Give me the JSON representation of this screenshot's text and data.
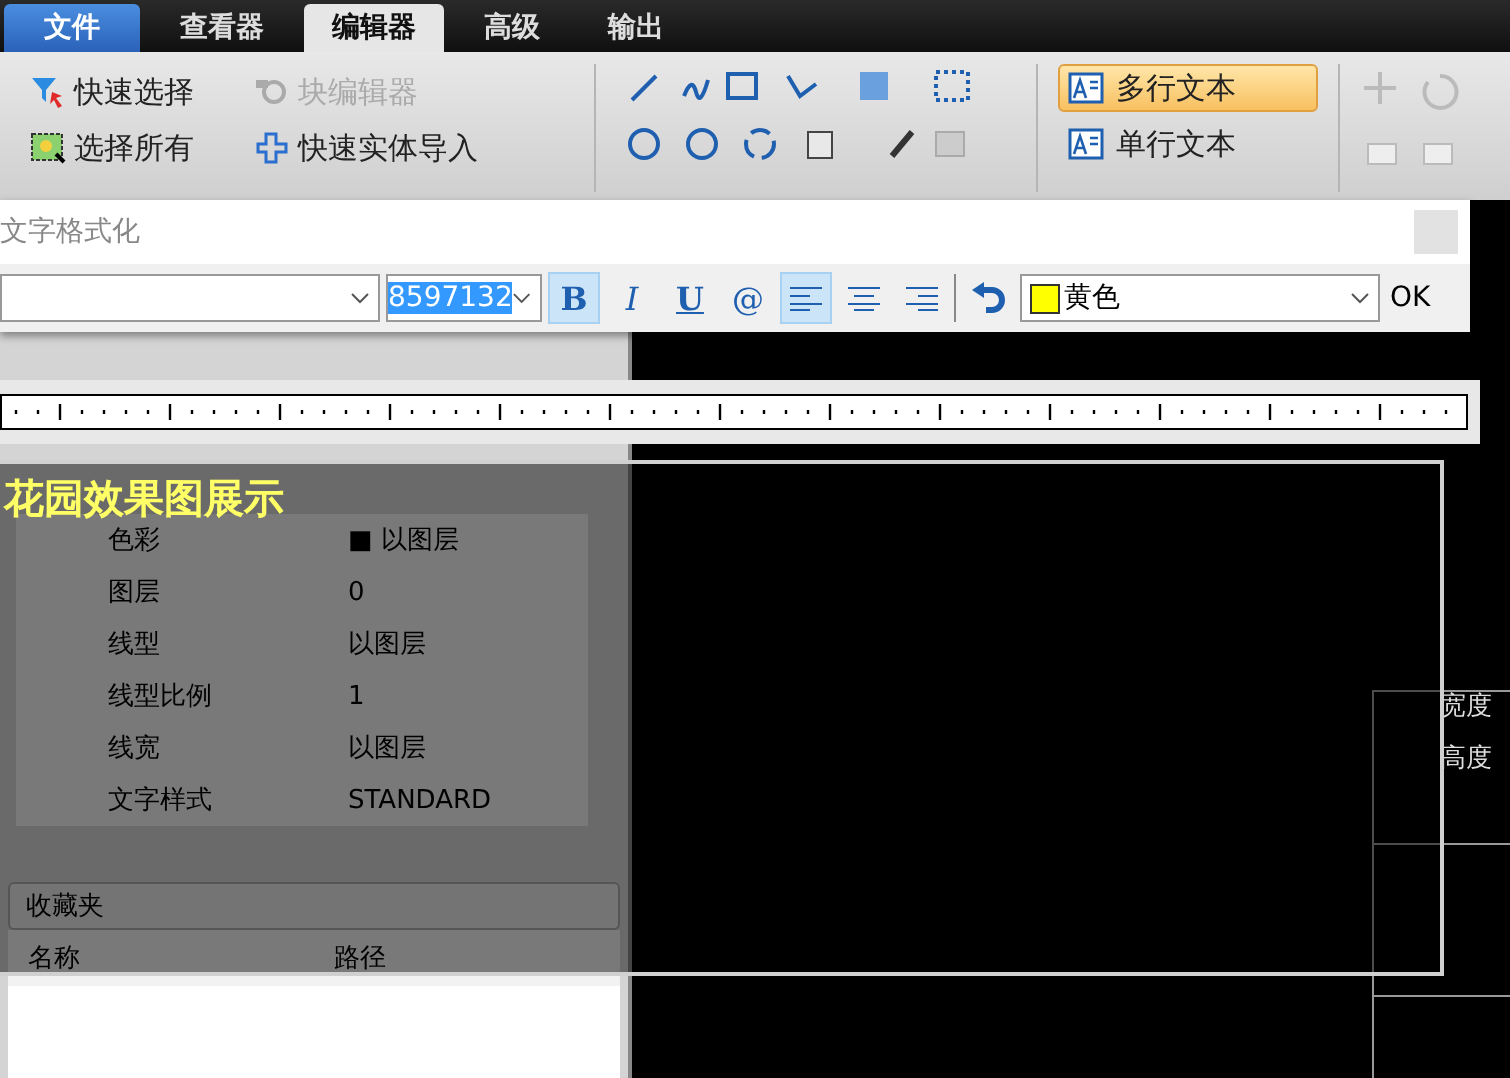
{
  "menu_tabs": [
    {
      "label": "文件",
      "kind": "file",
      "selected": false
    },
    {
      "label": "查看器",
      "kind": "tab",
      "selected": false
    },
    {
      "label": "编辑器",
      "kind": "tab",
      "selected": true
    },
    {
      "label": "高级",
      "kind": "tab",
      "selected": false
    },
    {
      "label": "输出",
      "kind": "tab",
      "selected": false
    }
  ],
  "ribbon": {
    "select_items": [
      {
        "label": "快速选择",
        "kind": "quick-select",
        "disabled": false
      },
      {
        "label": "块编辑器",
        "kind": "block-editor",
        "disabled": true
      },
      {
        "label": "选择所有",
        "kind": "select-all",
        "disabled": false
      },
      {
        "label": "快速实体导入",
        "kind": "import",
        "disabled": false
      }
    ],
    "text_items": [
      {
        "label": "多行文本",
        "selected": true
      },
      {
        "label": "单行文本",
        "selected": false
      }
    ]
  },
  "dialog": {
    "title": "文字格式化",
    "size": "8597132",
    "style_buttons": [
      {
        "label": "B",
        "kind": "bold",
        "selected": true
      },
      {
        "label": "I",
        "kind": "italic",
        "selected": false
      },
      {
        "label": "U",
        "kind": "underline",
        "selected": false
      },
      {
        "label": "@",
        "kind": "symbol",
        "selected": false
      }
    ],
    "align_buttons": [
      {
        "kind": "left",
        "selected": true
      },
      {
        "kind": "center",
        "selected": false
      },
      {
        "kind": "right",
        "selected": false
      }
    ],
    "text_color": {
      "label": "黄色",
      "color": "#ffff00"
    },
    "ok": "OK"
  },
  "properties": [
    {
      "name": "色彩",
      "value": "■ 以图层"
    },
    {
      "name": "图层",
      "value": "0"
    },
    {
      "name": "线型",
      "value": "以图层"
    },
    {
      "name": "线型比例",
      "value": "1"
    },
    {
      "name": "线宽",
      "value": "以图层"
    },
    {
      "name": "文字样式",
      "value": "STANDARD"
    }
  ],
  "favorites": {
    "title": "收藏夹",
    "columns": [
      "名称",
      "路径"
    ]
  },
  "editor": {
    "text": "花园效果图展示"
  },
  "canvas": {
    "labels": [
      "宽度",
      "高度"
    ]
  }
}
